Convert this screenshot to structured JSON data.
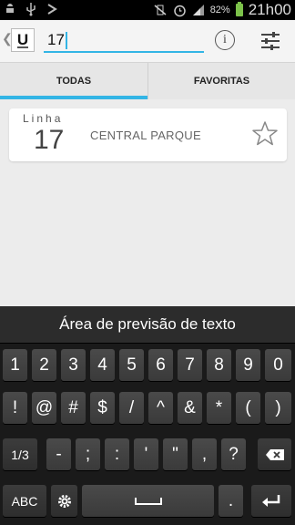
{
  "status_bar": {
    "battery_percent": "82%",
    "time": "21h00",
    "icons": [
      "android-icon",
      "usb-icon",
      "debug-icon",
      "vibrate-mute-icon",
      "alarm-icon",
      "signal-icon",
      "battery-charging-icon"
    ]
  },
  "action_bar": {
    "logo_text": "U",
    "search_value": "17",
    "info_icon_text": "i"
  },
  "tabs": [
    {
      "label": "TODAS",
      "selected": true
    },
    {
      "label": "FAVORITAS",
      "selected": false
    }
  ],
  "results": [
    {
      "label": "Linha",
      "number": "17",
      "name": "CENTRAL PARQUE",
      "favorite": false
    }
  ],
  "keyboard": {
    "prediction_text": "Área de previsão de texto",
    "row1": [
      "1",
      "2",
      "3",
      "4",
      "5",
      "6",
      "7",
      "8",
      "9",
      "0"
    ],
    "row2": [
      "!",
      "@",
      "#",
      "$",
      "/",
      "^",
      "&",
      "*",
      "(",
      ")"
    ],
    "row3": [
      "1/3",
      "-",
      ";",
      ":",
      "'",
      "\"",
      ",",
      "?"
    ],
    "row4": [
      "ABC",
      "."
    ]
  },
  "colors": {
    "accent": "#33b5e5",
    "battery": "#7cc24a"
  }
}
